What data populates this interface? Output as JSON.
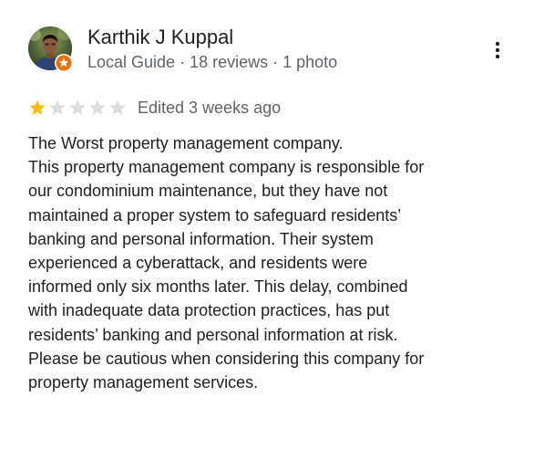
{
  "reviewer": {
    "name": "Karthik J Kuppal",
    "meta": "Local Guide · 18 reviews · 1 photo",
    "badge_icon": "local-guide-star-icon",
    "avatar": "profile-photo"
  },
  "review": {
    "rating": 1,
    "rating_max": 5,
    "edited": "Edited 3 weeks ago",
    "lines": [
      "The Worst property management company.",
      "This property management company is responsible for",
      "our condominium maintenance, but they have not",
      "maintained a proper system to safeguard residents’",
      "banking and personal information. Their system",
      "experienced a cyberattack, and residents were",
      "informed only six months later. This delay, combined",
      "with inadequate data protection practices, has put",
      "residents’ banking and personal information at risk.",
      "Please be cautious when considering this company for",
      "property management services."
    ]
  },
  "colors": {
    "star_filled": "#fbbc04",
    "star_empty": "#dadce0",
    "badge_orange": "#e8710a",
    "secondary_text": "#5f6368"
  },
  "icons": {
    "more": "more-vertical-icon",
    "star": "star-icon"
  }
}
